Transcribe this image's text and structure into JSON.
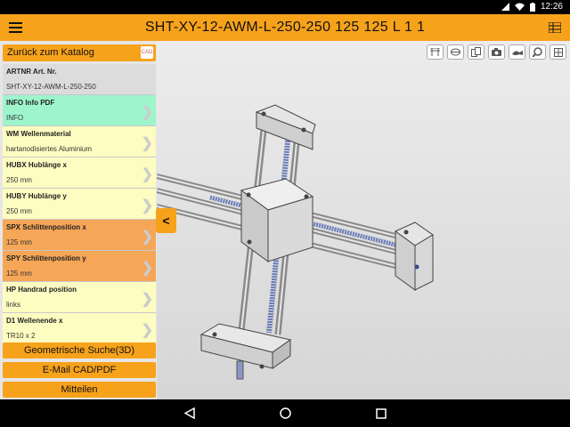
{
  "status": {
    "time": "12:26"
  },
  "app": {
    "title": "SHT-XY-12-AWM-L-250-250 125 125 L 1 1"
  },
  "sidebar": {
    "back_label": "Zurück zum Katalog",
    "back_badge": "CAD",
    "items": [
      {
        "label": "ARTNR Art. Nr.",
        "value": "SHT-XY-12-AWM-L-250-250",
        "color": "#dcdcdc"
      },
      {
        "label": "INFO Info PDF",
        "value": "INFO",
        "color": "#9ef5cb"
      },
      {
        "label": "WM Wellenmaterial",
        "value": "hartanodisiertes Aluminium",
        "color": "#fdfdc2"
      },
      {
        "label": "HUBX Hublänge x",
        "value": "250 mm",
        "color": "#fdfdc2"
      },
      {
        "label": "HUBY Hublänge y",
        "value": "250 mm",
        "color": "#fdfdc2"
      },
      {
        "label": "SPX Schlittenposition x",
        "value": "125 mm",
        "color": "#f6a657"
      },
      {
        "label": "SPY Schlittenposition y",
        "value": "125 mm",
        "color": "#f6a657"
      },
      {
        "label": "HP Handrad position",
        "value": "links",
        "color": "#fdfdc2"
      },
      {
        "label": "D1 Wellenende x",
        "value": "TR10 x 2",
        "color": "#fdfdc2"
      }
    ],
    "buttons": {
      "geo_search": "Geometrische Suche(3D)",
      "email": "E-Mail CAD/PDF",
      "share": "Mitteilen"
    },
    "collapse_label": "<"
  },
  "toolbar": {
    "icons": [
      "table-icon",
      "layers-icon",
      "documents-icon",
      "camera-icon",
      "tool-icon",
      "zoom-fit-icon",
      "grid-icon"
    ]
  },
  "colors": {
    "accent": "#f7a21b",
    "info": "#9ef5cb",
    "variable": "#fdfdc2",
    "position": "#f6a657"
  }
}
